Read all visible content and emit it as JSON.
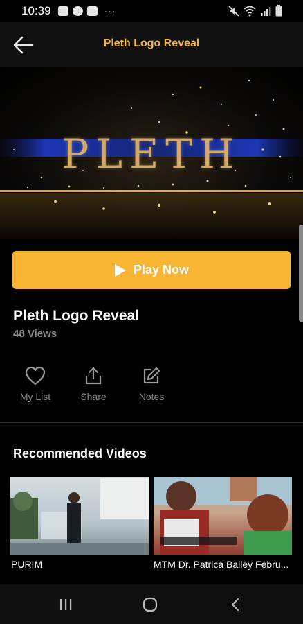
{
  "status_bar": {
    "time": "10:39",
    "more": "···",
    "left_icons": [
      "gallery-icon",
      "s-app-icon",
      "youtube-icon"
    ],
    "right_icons": [
      "mute-icon",
      "wifi-icon",
      "signal-icon",
      "battery-icon"
    ]
  },
  "header": {
    "title": "Pleth Logo Reveal",
    "back_icon": "arrow-left-icon"
  },
  "hero": {
    "logo_text": "PLETH"
  },
  "play_button": {
    "label": "Play Now",
    "icon": "play-icon"
  },
  "video": {
    "title": "Pleth Logo Reveal",
    "views": "48 Views"
  },
  "actions": [
    {
      "label": "My List",
      "icon": "heart-icon"
    },
    {
      "label": "Share",
      "icon": "share-icon"
    },
    {
      "label": "Notes",
      "icon": "edit-icon"
    }
  ],
  "recommended": {
    "title": "Recommended Videos",
    "items": [
      {
        "caption": "PURIM"
      },
      {
        "caption": "MTM Dr. Patrica Bailey Febru..."
      }
    ]
  },
  "nav": {
    "icons": [
      "recents-icon",
      "home-icon",
      "back-icon"
    ]
  },
  "colors": {
    "accent": "#f8b433",
    "header_title": "#f6b733",
    "muted": "#8c8c8c",
    "background": "#000000"
  }
}
